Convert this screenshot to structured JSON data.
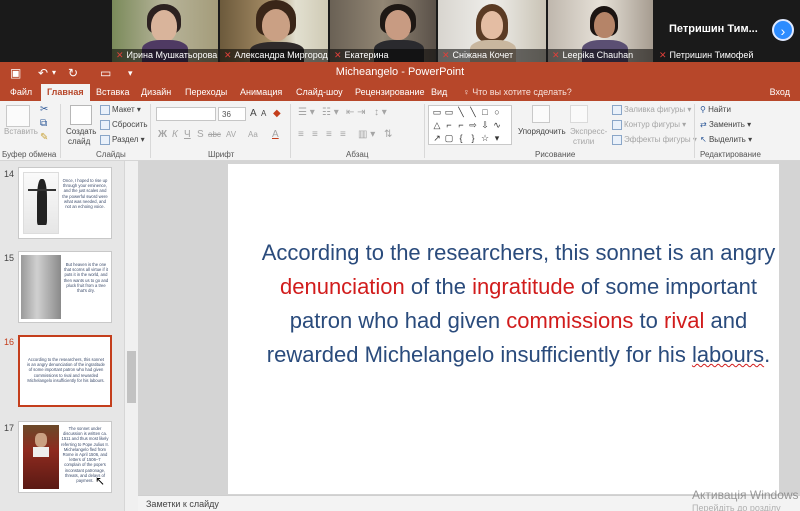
{
  "video": {
    "participants": [
      {
        "name": "Ирина Мушкатьорова"
      },
      {
        "name": "Александра Миргородс..."
      },
      {
        "name": "Екатерина"
      },
      {
        "name": "Сніжана Кочет"
      },
      {
        "name": "Leepika Chauhan"
      }
    ],
    "speaker_big_name": "Петришин Тим...",
    "speaker_name": "Петришин Тимофей",
    "next_icon": "›"
  },
  "app": {
    "doc_title": "Micheangelo - PowerPoint",
    "tabs": [
      "Файл",
      "Главная",
      "Вставка",
      "Дизайн",
      "Переходы",
      "Анимация",
      "Слайд-шоу",
      "Рецензирование",
      "Вид"
    ],
    "tell_me": "Что вы хотите сделать?",
    "signin": "Вход"
  },
  "ribbon": {
    "clipboard": {
      "paste": "Вставить",
      "label": "Буфер обмена"
    },
    "slides": {
      "new_slide": "Создать",
      "new_slide2": "слайд",
      "layout": "Макет",
      "reset": "Сбросить",
      "section": "Раздел",
      "label": "Слайды"
    },
    "font": {
      "font_size": "36",
      "label": "Шрифт",
      "bold": "Ж",
      "italic": "К",
      "underline": "Ч",
      "shadow": "S",
      "strike": "abc",
      "spacing": "AV",
      "case": "Aa",
      "color": "A",
      "grow": "A",
      "shrink": "A"
    },
    "paragraph": {
      "label": "Абзац"
    },
    "drawing": {
      "arrange": "Упорядочить",
      "quick_styles": "Экспресс-",
      "quick_styles2": "стили",
      "fill": "Заливка фигуры",
      "outline": "Контур фигуры",
      "effects": "Эффекты фигуры",
      "label": "Рисование"
    },
    "editing": {
      "find": "Найти",
      "replace": "Заменить",
      "select": "Выделить",
      "label": "Редактирование"
    }
  },
  "thumbnails": [
    {
      "number": "14",
      "text": "Once, I hoped to rise up through your eminence, and the just scales and the powerful sword were what was needed, and not an echoing voice."
    },
    {
      "number": "15",
      "text": "But heaven is the one that scorns all virtue if it puts it in the world, and then wants us to go and pluck fruit from a tree that's dry."
    },
    {
      "number": "16",
      "text": "According to the researchers, this sonnet is an angry denunciation of the ingratitude of some important patron who had given commissions to rival and rewarded Michelangelo insufficiently for his labours."
    },
    {
      "number": "17",
      "text": "The sonnet under discussion is written ca. 1511 and thus most likely referring to Pope Julius II. Michelangelo fled from Rome in April 1506, and letters of 1506–7 complain of the pope's inconstant patronage, threats, and delays of payment."
    }
  ],
  "slide": {
    "segments": [
      {
        "t": "According to the researchers, this sonnet is an angry ",
        "style": "n"
      },
      {
        "t": "denunciation",
        "style": "r"
      },
      {
        "t": " of the ",
        "style": "n"
      },
      {
        "t": "ingratitude",
        "style": "r"
      },
      {
        "t": " of some important patron who had given ",
        "style": "n"
      },
      {
        "t": "commissions",
        "style": "r"
      },
      {
        "t": " to ",
        "style": "n"
      },
      {
        "t": "rival",
        "style": "r"
      },
      {
        "t": " and  rewarded Michelangelo insufficiently for his ",
        "style": "n"
      },
      {
        "t": "labours",
        "style": "u"
      },
      {
        "t": ".",
        "style": "n"
      }
    ],
    "text_color": "#2a4b7c",
    "highlight_color": "#d11c1c"
  },
  "notes": {
    "label": "Заметки к слайду"
  },
  "watermark": {
    "title": "Активація Windows",
    "subtitle": "Перейдіть до розділу"
  },
  "theme": {
    "accent": "#b7472a",
    "selection": "#c43e1c"
  }
}
